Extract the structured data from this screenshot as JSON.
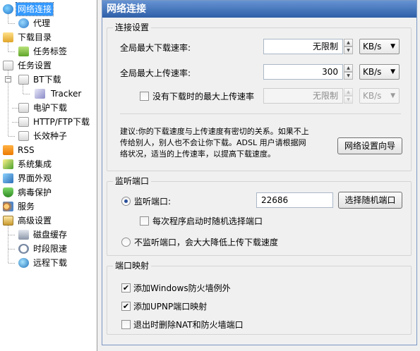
{
  "tree": {
    "items": [
      {
        "label": "网络连接"
      },
      {
        "label": "代理"
      },
      {
        "label": "下载目录"
      },
      {
        "label": "任务标签"
      },
      {
        "label": "任务设置"
      },
      {
        "label": "BT下载"
      },
      {
        "label": "Tracker"
      },
      {
        "label": "电驴下载"
      },
      {
        "label": "HTTP/FTP下载"
      },
      {
        "label": "长效种子"
      },
      {
        "label": "RSS"
      },
      {
        "label": "系统集成"
      },
      {
        "label": "界面外观"
      },
      {
        "label": "病毒保护"
      },
      {
        "label": "服务"
      },
      {
        "label": "高级设置"
      },
      {
        "label": "磁盘缓存"
      },
      {
        "label": "时段限速"
      },
      {
        "label": "远程下载"
      }
    ]
  },
  "panel": {
    "title": "网络连接",
    "connection": {
      "title": "连接设置",
      "max_download_label": "全局最大下载速率:",
      "max_download_value": "无限制",
      "max_download_unit": "KB/s",
      "max_upload_label": "全局最大上传速率:",
      "max_upload_value": "300",
      "max_upload_unit": "KB/s",
      "idle_upload_label": "没有下载时的最大上传速率",
      "idle_upload_value": "无限制",
      "idle_upload_unit": "KB/s",
      "advice_line1": "建议:你的下载速度与上传速度有密切的关系。如果不上",
      "advice_line2": "传给别人，别人也不会让你下载。ADSL 用户请根据网",
      "advice_line3": "络状况，适当的上传速率，以提高下载速度。",
      "wizard_button": "网络设置向导"
    },
    "listen": {
      "title": "监听端口",
      "port_label": "监听端口:",
      "port_value": "22686",
      "random_button": "选择随机端口",
      "random_on_start_label": "每次程序启动时随机选择端口",
      "no_listen_label": "不监听端口，会大大降低上传下载速度"
    },
    "mapping": {
      "title": "端口映射",
      "firewall_label": "添加Windows防火墙例外",
      "upnp_label": "添加UPNP端口映射",
      "cleanup_label": "退出时删除NAT和防火墙端口"
    }
  }
}
